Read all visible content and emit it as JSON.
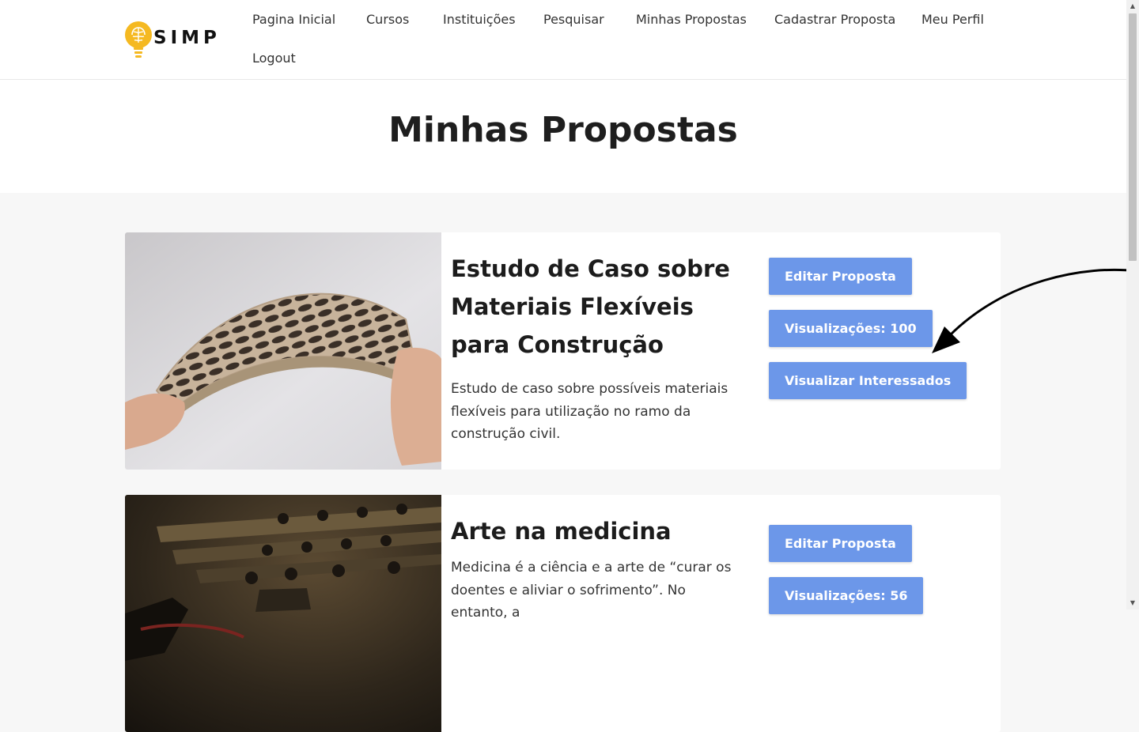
{
  "brand": {
    "name": "SIMP",
    "accent": "#f5b921"
  },
  "nav": [
    {
      "label": "Pagina Inicial"
    },
    {
      "label": "Cursos"
    },
    {
      "label": "Instituições"
    },
    {
      "label": "Pesquisar"
    },
    {
      "label": "Minhas Propostas"
    },
    {
      "label": "Cadastrar Proposta"
    },
    {
      "label": "Meu Perfil"
    },
    {
      "label": "Logout"
    }
  ],
  "page_title": "Minhas Propostas",
  "proposals": [
    {
      "title": "Estudo de Caso sobre Materiais Flexíveis para Construção",
      "description": "Estudo de caso sobre possíveis materiais flexíveis para utilização no ramo da construção civil.",
      "edit_label": "Editar Proposta",
      "views_label": "Visualizações: 100",
      "interested_label": "Visualizar Interessados"
    },
    {
      "title": "Arte na medicina",
      "description": "Medicina é a ciência e a arte de “curar os doentes e aliviar o sofrimento”. No entanto, a",
      "edit_label": "Editar Proposta",
      "views_label": "Visualizações: 56"
    }
  ],
  "colors": {
    "button": "#6c97e9",
    "background": "#f7f7f7"
  }
}
